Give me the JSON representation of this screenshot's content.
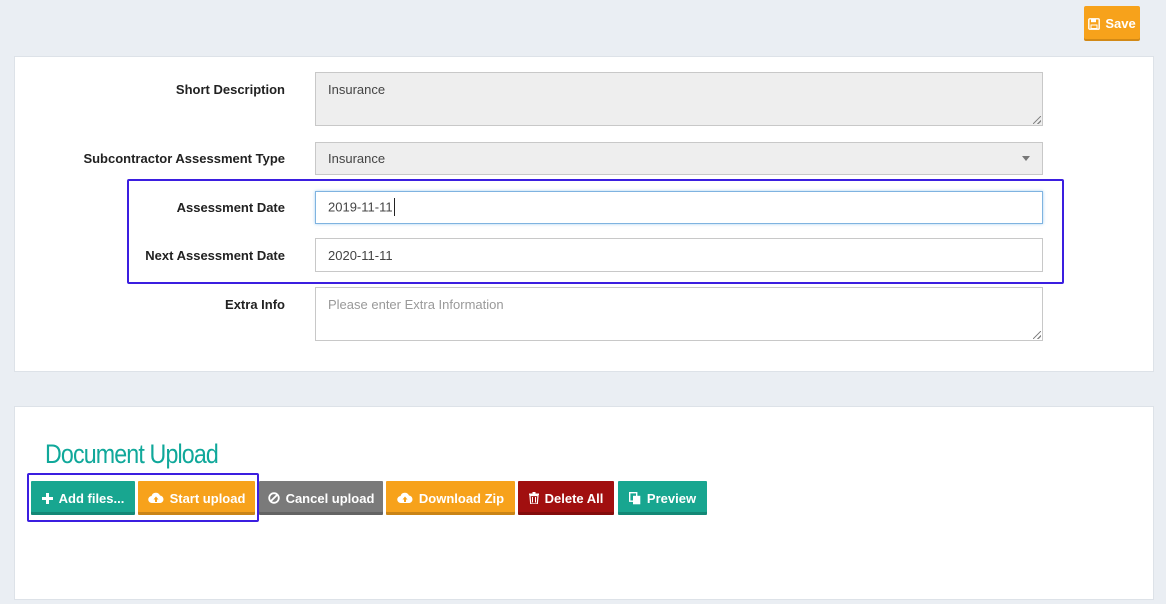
{
  "toolbar": {
    "save_label": "Save"
  },
  "form": {
    "short_description": {
      "label": "Short Description",
      "value": "Insurance"
    },
    "assessment_type": {
      "label": "Subcontractor Assessment Type",
      "value": "Insurance"
    },
    "assessment_date": {
      "label": "Assessment Date",
      "value": "2019-11-11"
    },
    "next_assessment_date": {
      "label": "Next Assessment Date",
      "value": "2020-11-11"
    },
    "extra_info": {
      "label": "Extra Info",
      "placeholder": "Please enter Extra Information",
      "value": ""
    }
  },
  "upload": {
    "title": "Document Upload",
    "buttons": {
      "add_files": "Add files...",
      "start_upload": "Start upload",
      "cancel_upload": "Cancel upload",
      "download_zip": "Download Zip",
      "delete_all": "Delete All",
      "preview": "Preview"
    }
  },
  "colors": {
    "accent_teal": "#18a690",
    "accent_orange": "#f7a21b",
    "danger_red": "#a10f0f",
    "highlight_box": "#3b1ee0"
  },
  "icons": {
    "save": "floppy-disk-icon",
    "add_files": "plus-icon",
    "start_upload": "cloud-upload-icon",
    "cancel_upload": "ban-icon",
    "download_zip": "cloud-upload-icon",
    "delete_all": "trash-icon",
    "preview": "copy-icon"
  }
}
